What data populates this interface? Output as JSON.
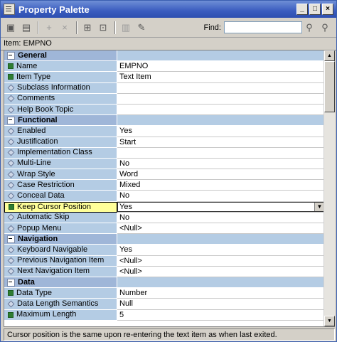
{
  "window": {
    "title": "Property Palette"
  },
  "toolbar": {
    "find_label": "Find:",
    "find_value": ""
  },
  "item_line": "Item: EMPNO",
  "rows": [
    {
      "type": "group",
      "name": "General",
      "value": ""
    },
    {
      "type": "prop",
      "marker": "square",
      "name": "Name",
      "value": "EMPNO"
    },
    {
      "type": "prop",
      "marker": "square",
      "name": "Item Type",
      "value": "Text Item"
    },
    {
      "type": "prop",
      "marker": "diamond",
      "name": "Subclass Information",
      "value": ""
    },
    {
      "type": "prop",
      "marker": "diamond",
      "name": "Comments",
      "value": ""
    },
    {
      "type": "prop",
      "marker": "diamond",
      "name": "Help Book Topic",
      "value": ""
    },
    {
      "type": "group",
      "name": "Functional",
      "value": ""
    },
    {
      "type": "prop",
      "marker": "diamond",
      "name": "Enabled",
      "value": "Yes"
    },
    {
      "type": "prop",
      "marker": "diamond",
      "name": "Justification",
      "value": "Start"
    },
    {
      "type": "prop",
      "marker": "diamond",
      "name": "Implementation Class",
      "value": ""
    },
    {
      "type": "prop",
      "marker": "diamond",
      "name": "Multi-Line",
      "value": "No"
    },
    {
      "type": "prop",
      "marker": "diamond",
      "name": "Wrap Style",
      "value": "Word"
    },
    {
      "type": "prop",
      "marker": "diamond",
      "name": "Case Restriction",
      "value": "Mixed"
    },
    {
      "type": "prop",
      "marker": "diamond",
      "name": "Conceal Data",
      "value": "No"
    },
    {
      "type": "selected",
      "marker": "square",
      "name": "Keep Cursor Position",
      "value": "Yes"
    },
    {
      "type": "prop",
      "marker": "diamond",
      "name": "Automatic Skip",
      "value": "No"
    },
    {
      "type": "prop",
      "marker": "diamond",
      "name": "Popup Menu",
      "value": "<Null>"
    },
    {
      "type": "group",
      "name": "Navigation",
      "value": ""
    },
    {
      "type": "prop",
      "marker": "diamond",
      "name": "Keyboard Navigable",
      "value": "Yes"
    },
    {
      "type": "prop",
      "marker": "diamond",
      "name": "Previous Navigation Item",
      "value": "<Null>"
    },
    {
      "type": "prop",
      "marker": "diamond",
      "name": "Next Navigation Item",
      "value": "<Null>"
    },
    {
      "type": "group",
      "name": "Data",
      "value": ""
    },
    {
      "type": "prop",
      "marker": "square",
      "name": "Data Type",
      "value": "Number"
    },
    {
      "type": "prop",
      "marker": "diamond",
      "name": "Data Length Semantics",
      "value": "Null"
    },
    {
      "type": "prop",
      "marker": "square",
      "name": "Maximum Length",
      "value": "5"
    }
  ],
  "status": "Cursor position is the same upon re-entering the text item as when last exited."
}
